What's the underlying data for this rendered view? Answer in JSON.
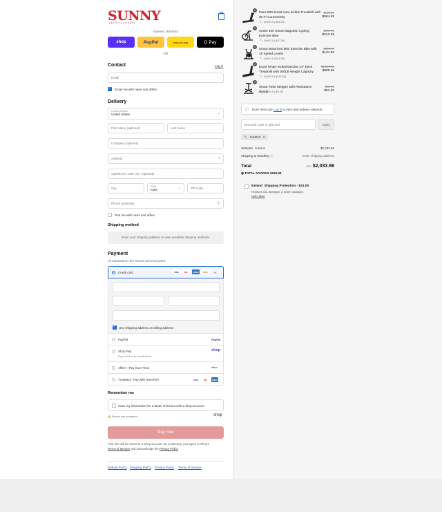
{
  "brand": {
    "logo": "SUNNY",
    "tagline": "HEALTH & FITNESS"
  },
  "express": {
    "label": "Express checkout",
    "buttons": [
      "shop",
      "PayPal",
      "amazon pay",
      "G Pay"
    ],
    "or": "OR"
  },
  "contact": {
    "title": "Contact",
    "login": "Log in",
    "email_placeholder": "Email",
    "newsletter": "Email me with news and offers"
  },
  "delivery": {
    "title": "Delivery",
    "country_label": "Country/Region",
    "country_value": "United States",
    "first_name": "First name (optional)",
    "last_name": "Last name",
    "company": "Company (optional)",
    "address": "Address",
    "apartment": "Apartment, suite, etc. (optional)",
    "city": "City",
    "state_label": "State",
    "state_value": "Iowa",
    "zip": "ZIP code",
    "phone": "Phone (optional)",
    "text_me": "Text me with news and offers"
  },
  "shipping_method": {
    "title": "Shipping method",
    "message": "Enter your shipping address to view available shipping methods."
  },
  "payment": {
    "title": "Payment",
    "subtitle": "All transactions are secure and encrypted.",
    "credit_card": "Credit card",
    "card_brands": [
      "VISA",
      "MC",
      "AMEX",
      "DISC"
    ],
    "more_cards": "+4",
    "billing_same": "Use shipping address as billing address",
    "options": [
      {
        "label": "PayPal",
        "sub": "",
        "logo": "PayPal"
      },
      {
        "label": "Shop Pay",
        "sub": "Pay in full or in installments",
        "logo": "shop"
      },
      {
        "label": "Affirm - Pay Over Time",
        "sub": "",
        "logo": "affirm"
      },
      {
        "label": "TrueMed - Pay with HSA/FSA",
        "sub": "",
        "logo": "VISA MC AMEX"
      }
    ]
  },
  "remember": {
    "title": "Remember me",
    "save_info": "Save my information for a faster checkout with a Shop account",
    "secure": "Secure and encrypted",
    "shop_logo": "shop"
  },
  "pay_now": "Pay now",
  "legal": {
    "line1": "Your info will be saved to a Shop account. By continuing, you agree to Shop's",
    "terms": "Terms of Service",
    "and": "and acknowledge the",
    "privacy": "Privacy Policy",
    "end": "."
  },
  "footer": [
    "Refund Policy",
    "Shipping Policy",
    "Privacy Policy",
    "Terms of Service"
  ],
  "cart": {
    "items": [
      {
        "qty": "1",
        "name": "Pace 500 Smart Auto Incline Treadmill with Wi-Fi Connectivity",
        "save": "SAVE10 (-$65.00)",
        "old": "$649.99",
        "new": "$584.99"
      },
      {
        "qty": "1",
        "name": "Active 100 Smart Magnetic Cycling Exercise Bike",
        "save": "SAVE10 (-$27.00)",
        "old": "$269.99",
        "new": "$242.99"
      },
      {
        "qty": "1",
        "name": "Smart Motorized Mini Exercise Bike with 16 Speed Levels",
        "save": "SAVE10 (-$15.00)",
        "old": "$149.99",
        "new": "$134.99"
      },
      {
        "qty": "1",
        "name": "Excel Smart Incline/Decline 23\" Deck Treadmill with 300LB Weight Capacity",
        "save": "SAVE10 (-$110.00)",
        "old": "$1,099.99",
        "new": "$989.99"
      },
      {
        "qty": "1",
        "name": "Smart Twist Stepper with Resistance Bands",
        "save": "SAVE10 (-$9.00)",
        "old": "$89.99",
        "new": "$81.00"
      }
    ],
    "rewards": {
      "pre": "Don't miss out!",
      "link": "Log in",
      "post": "to earn and redeem rewards."
    },
    "discount_placeholder": "Discount code or gift card",
    "apply": "Apply",
    "applied_code": "SAVE10",
    "subtotal_label": "Subtotal · 5 items",
    "subtotal_value": "$2,033.96",
    "shipping_label": "Shipping & Handling",
    "shipping_value": "Enter shipping address",
    "total_label": "Total",
    "currency": "USD",
    "total_value": "$2,033.96",
    "savings_label": "TOTAL SAVINGS",
    "savings_value": "$225.99",
    "protection": {
      "brand": "Extend",
      "title": "Shipping Protection - $41.00",
      "desc": "Replaces lost, damaged, or stolen packages.",
      "link": "Learn More"
    }
  }
}
